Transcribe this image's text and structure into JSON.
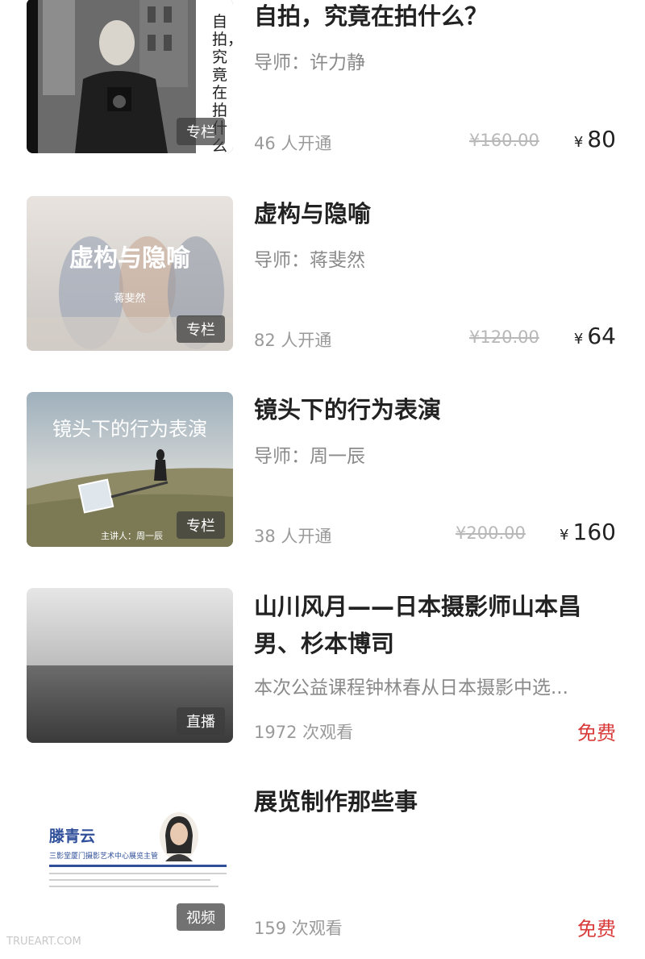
{
  "items": [
    {
      "title": "自拍，究竟在拍什么？",
      "mentor": "导师：许力静",
      "stats": "46 人开通",
      "original_price": "¥160.00",
      "currency": "¥",
      "price": "80",
      "badge": "专栏",
      "cover_text": "自拍，究竟在拍什么"
    },
    {
      "title": "虚构与隐喻",
      "mentor": "导师：蒋斐然",
      "stats": "82 人开通",
      "original_price": "¥120.00",
      "currency": "¥",
      "price": "64",
      "badge": "专栏",
      "cover_text": "虚构与隐喻",
      "cover_sub": "蒋斐然"
    },
    {
      "title": "镜头下的行为表演",
      "mentor": "导师：周一辰",
      "stats": "38 人开通",
      "original_price": "¥200.00",
      "currency": "¥",
      "price": "160",
      "badge": "专栏",
      "cover_text": "镜头下的行为表演",
      "cover_sub": "主讲人：周一辰"
    },
    {
      "title": "山川风月——日本摄影师山本昌男、杉本博司",
      "description": "本次公益课程钟林春从日本摄影中选...",
      "stats": "1972 次观看",
      "price_label": "免费",
      "badge": "直播"
    },
    {
      "title": "展览制作那些事",
      "stats": "159 次观看",
      "price_label": "免费",
      "badge": "视频",
      "cover_name": "滕青云",
      "cover_role": "三影堂厦门摄影艺术中心展览主管"
    }
  ],
  "watermark": "TRUEART.COM",
  "colors": {
    "free": "#d93a3a",
    "badge_bg": "#3c3c3c"
  }
}
